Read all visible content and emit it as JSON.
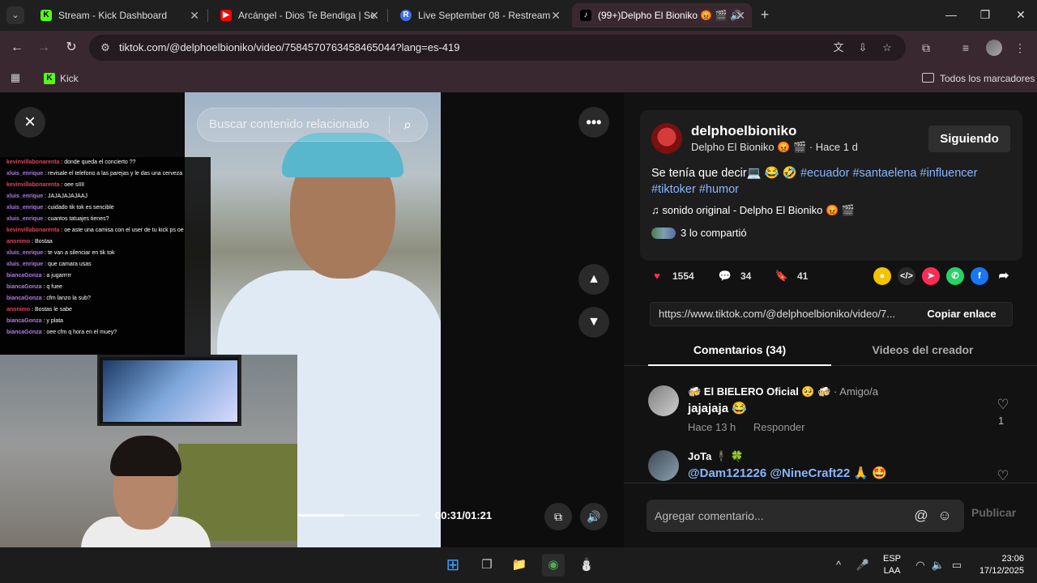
{
  "browser": {
    "tabs": [
      {
        "title": "Stream - Kick Dashboard",
        "favicon": "kick-icon",
        "active": false
      },
      {
        "title": "Arcángel - Dios Te Bendiga | Se",
        "favicon": "youtube-icon",
        "active": false
      },
      {
        "title": "Live September 08 - Restream",
        "favicon": "restream-icon",
        "active": false
      },
      {
        "title": "(99+)Delpho El Bioniko 😡 🎬 🔊",
        "favicon": "tiktok-icon",
        "active": true
      }
    ],
    "url": "tiktok.com/@delphoelbioniko/video/7584570763458465044?lang=es-419",
    "bookmarks": [
      {
        "label": "Kick"
      }
    ],
    "all_bookmarks_label": "Todos los marcadores"
  },
  "player": {
    "search_placeholder": "Buscar contenido relacionado",
    "time": "00:31/01:21",
    "progress": 0.38
  },
  "chat": [
    {
      "user": "kevinvillabonarenta",
      "color": "#e0435c",
      "text": "donde queda el concierto ??"
    },
    {
      "user": "xluis_enrique",
      "color": "#b07be6",
      "text": "revisale el telefono a las parejas y le das una cerveza"
    },
    {
      "user": "kevinvillabonarenta",
      "color": "#e0435c",
      "text": "oee sIIII"
    },
    {
      "user": "xluis_enrique",
      "color": "#b07be6",
      "text": "JAJAJAJAJAAJ"
    },
    {
      "user": "xluis_enrique",
      "color": "#b07be6",
      "text": "cuidado tik tok es sencible"
    },
    {
      "user": "xluis_enrique",
      "color": "#b07be6",
      "text": "cuantos tatuajes tienes?"
    },
    {
      "user": "kevinvillabonarenta",
      "color": "#e0435c",
      "text": "oe aste una camisa con el user de tu kick ps oe"
    },
    {
      "user": "anonimo",
      "color": "#e0435c",
      "text": "Bostaa"
    },
    {
      "user": "xluis_enrique",
      "color": "#b07be6",
      "text": "te van a silenciar en tik tok"
    },
    {
      "user": "xluis_enrique",
      "color": "#b07be6",
      "text": "que camara usas"
    },
    {
      "user": "biancaGonza",
      "color": "#b07be6",
      "text": "a jugarrrrr"
    },
    {
      "user": "biancaGonza",
      "color": "#b07be6",
      "text": "q fuee"
    },
    {
      "user": "biancaGonza",
      "color": "#b07be6",
      "text": "cfm lanzo la sub?"
    },
    {
      "user": "anonimo",
      "color": "#e0435c",
      "text": "Bostas le sabe"
    },
    {
      "user": "biancaGonza",
      "color": "#b07be6",
      "text": "y plata"
    },
    {
      "user": "biancaGonza",
      "color": "#b07be6",
      "text": "oee cfm q hora en el muey?"
    }
  ],
  "video_info": {
    "username": "delphoelbioniko",
    "display_name": "Delpho El Bioniko 😡 🎬",
    "posted": "· Hace 1 d",
    "follow_label": "Siguiendo",
    "desc_text": "Se tenía que decir💻 😂 🤣",
    "hashtags": [
      "#ecuador",
      "#santaelena",
      "#influencer",
      "#tiktoker",
      "#humor"
    ],
    "sound": "sonido original - Delpho El Bioniko 😡 🎬",
    "shared": "3 lo compartió",
    "likes": "1554",
    "comments": "34",
    "saves": "41",
    "link": "https://www.tiktok.com/@delphoelbioniko/video/7...",
    "copy_label": "Copiar enlace"
  },
  "tabs_panel": {
    "comments_tab": "Comentarios (34)",
    "creator_tab": "Videos del creador"
  },
  "comments": [
    {
      "name": "🍻 El BIELERO Oficial 🥺 🍻",
      "relation": "· Amigo/a",
      "text": "jajajaja 😂",
      "time": "Hace 13 h",
      "reply": "Responder",
      "likes": "1"
    },
    {
      "name": "JoTa 🕴 🍀",
      "relation": "",
      "text": "@Dam121226 @NineCraft22 🙏 🤩",
      "time": "",
      "reply": "",
      "likes": ""
    }
  ],
  "compose": {
    "placeholder": "Agregar comentario...",
    "post_label": "Publicar"
  },
  "taskbar": {
    "lang_line1": "ESP",
    "lang_line2": "LAA",
    "time": "23:06",
    "date": "17/12/2025"
  },
  "colors": {
    "accent_pink": "#fe2c55",
    "hashtag_blue": "#86b7ff",
    "kick_green": "#53fc18"
  }
}
